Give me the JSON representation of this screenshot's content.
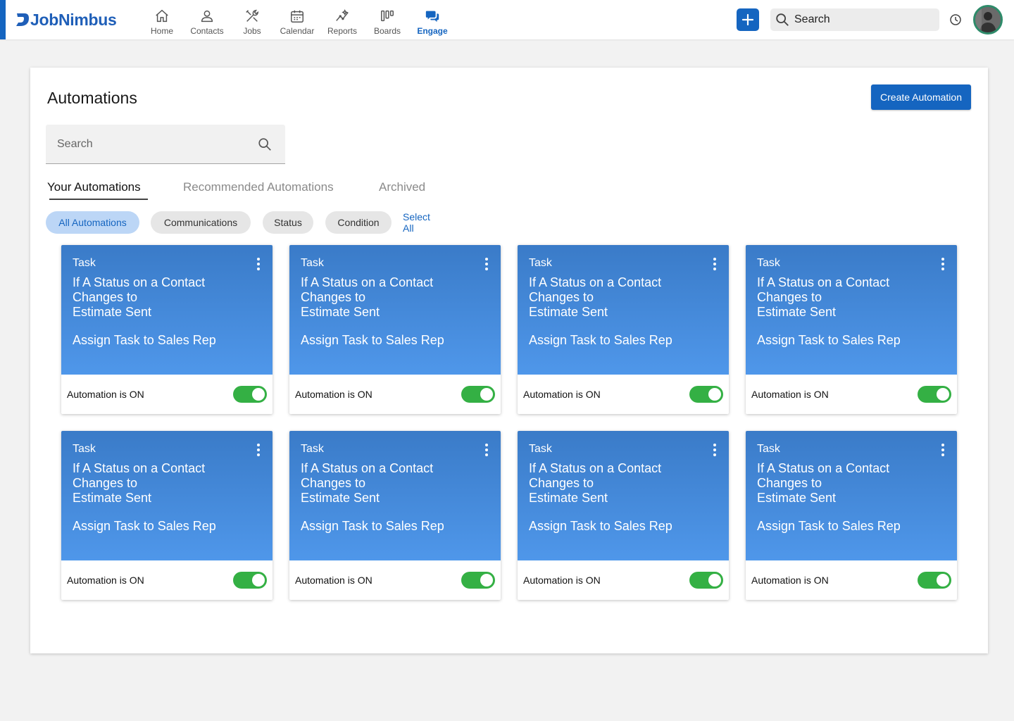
{
  "app": {
    "name": "JobNimbus",
    "accent": "#1565c0"
  },
  "nav": [
    {
      "label": "Home",
      "icon": "home-icon"
    },
    {
      "label": "Contacts",
      "icon": "person-icon"
    },
    {
      "label": "Jobs",
      "icon": "tools-icon"
    },
    {
      "label": "Calendar",
      "icon": "calendar-icon"
    },
    {
      "label": "Reports",
      "icon": "chart-line-icon"
    },
    {
      "label": "Boards",
      "icon": "columns-icon"
    },
    {
      "label": "Engage",
      "icon": "chat-icon",
      "active": true
    }
  ],
  "header": {
    "search_placeholder": "Search"
  },
  "page": {
    "title": "Automations",
    "create_button": "Create Automation",
    "search_placeholder": "Search",
    "tabs": [
      "Your Automations",
      "Recommended Automations",
      "Archived"
    ],
    "active_tab": "Your Automations",
    "filters": [
      "All Automations",
      "Communications",
      "Status",
      "Condition"
    ],
    "selected_filter": "All Automations",
    "select_all": "Select All"
  },
  "cards": [
    {
      "type": "Task",
      "trigger": "If A Status on a Contact\nChanges to\nEstimate Sent",
      "action": "Assign Task to Sales Rep",
      "status": "Automation is ON",
      "enabled": true
    },
    {
      "type": "Task",
      "trigger": "If A Status on a Contact\nChanges to\nEstimate Sent",
      "action": "Assign Task to Sales Rep",
      "status": "Automation is ON",
      "enabled": true
    },
    {
      "type": "Task",
      "trigger": "If A Status on a Contact\nChanges to\nEstimate Sent",
      "action": "Assign Task to Sales Rep",
      "status": "Automation is ON",
      "enabled": true
    },
    {
      "type": "Task",
      "trigger": "If A Status on a Contact\nChanges to\nEstimate Sent",
      "action": "Assign Task to Sales Rep",
      "status": "Automation is ON",
      "enabled": true
    },
    {
      "type": "Task",
      "trigger": "If A Status on a Contact\nChanges to\nEstimate Sent",
      "action": "Assign Task to Sales Rep",
      "status": "Automation is ON",
      "enabled": true
    },
    {
      "type": "Task",
      "trigger": "If A Status on a Contact\nChanges to\nEstimate Sent",
      "action": "Assign Task to Sales Rep",
      "status": "Automation is ON",
      "enabled": true
    },
    {
      "type": "Task",
      "trigger": "If A Status on a Contact\nChanges to\nEstimate Sent",
      "action": "Assign Task to Sales Rep",
      "status": "Automation is ON",
      "enabled": true
    },
    {
      "type": "Task",
      "trigger": "If A Status on a Contact\nChanges to\nEstimate Sent",
      "action": "Assign Task to Sales Rep",
      "status": "Automation is ON",
      "enabled": true
    }
  ],
  "colors": {
    "card_gradient_top": "#3a7bc8",
    "card_gradient_bottom": "#4f97ea",
    "toggle_on": "#34b044",
    "chip_selected": "#bcd6f6"
  }
}
